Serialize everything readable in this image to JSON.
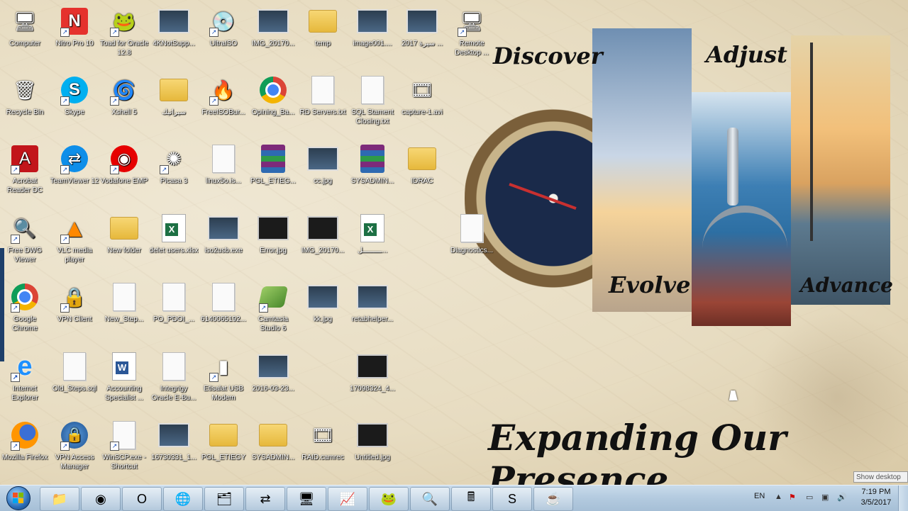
{
  "wallpaper": {
    "discover": "Discover",
    "adjust": "Adjust",
    "evolve": "Evolve",
    "advance": "Advance",
    "slogan": "Expanding Our Presence"
  },
  "icons": [
    {
      "label": "Computer",
      "glyph": "🖥",
      "type": "glyph",
      "name": "computer-icon",
      "shortcut": false
    },
    {
      "label": "Nitro Pro 10",
      "glyph": "N",
      "type": "nitro",
      "name": "nitro-pro-icon",
      "shortcut": true
    },
    {
      "label": "Toad for Oracle 12.8",
      "glyph": "🐸",
      "type": "glyph",
      "name": "toad-icon",
      "shortcut": true
    },
    {
      "label": "4KNotSupp...",
      "glyph": "",
      "type": "img",
      "name": "image-file-icon",
      "shortcut": false
    },
    {
      "label": "UltraISO",
      "glyph": "💿",
      "type": "glyph",
      "name": "ultraiso-icon",
      "shortcut": true
    },
    {
      "label": "IMG_20170...",
      "glyph": "",
      "type": "img",
      "name": "image-file-icon",
      "shortcut": false
    },
    {
      "label": "temp",
      "glyph": "",
      "type": "folder",
      "name": "folder-icon",
      "shortcut": false
    },
    {
      "label": "image001....",
      "glyph": "",
      "type": "img",
      "name": "image-file-icon",
      "shortcut": false
    },
    {
      "label": "2017 سيرة ...",
      "glyph": "",
      "type": "img",
      "name": "image-file-icon",
      "shortcut": false
    },
    {
      "label": "Remote Desktop ...",
      "glyph": "🖥",
      "type": "glyph",
      "name": "remote-desktop-icon",
      "shortcut": true
    },
    {
      "label": "Recycle Bin",
      "glyph": "🗑",
      "type": "glyph",
      "name": "recycle-bin-icon",
      "shortcut": false
    },
    {
      "label": "Skype",
      "glyph": "S",
      "type": "skype",
      "name": "skype-icon",
      "shortcut": true
    },
    {
      "label": "Xshell 5",
      "glyph": "🌀",
      "type": "glyph",
      "name": "xshell-icon",
      "shortcut": true
    },
    {
      "label": "سيراتيك",
      "glyph": "",
      "type": "folder",
      "name": "folder-icon",
      "shortcut": false
    },
    {
      "label": "FreeISOBur...",
      "glyph": "🔥",
      "type": "glyph",
      "name": "freeisoburner-icon",
      "shortcut": true
    },
    {
      "label": "Opining_Ba...",
      "glyph": "",
      "type": "chrome",
      "name": "chrome-html-icon",
      "shortcut": false
    },
    {
      "label": "RD Servers.txt",
      "glyph": "",
      "type": "file",
      "name": "text-file-icon",
      "shortcut": false
    },
    {
      "label": "SQL Stament Closing.txt",
      "glyph": "",
      "type": "file",
      "name": "text-file-icon",
      "shortcut": false
    },
    {
      "label": "capture-1.avi",
      "glyph": "🎞",
      "type": "glyph",
      "name": "video-file-icon",
      "shortcut": false
    },
    {
      "label": "Acrobat Reader DC",
      "glyph": "A",
      "type": "acrobat",
      "name": "acrobat-icon",
      "shortcut": true
    },
    {
      "label": "TeamViewer 12",
      "glyph": "⇄",
      "type": "teamviewer",
      "name": "teamviewer-icon",
      "shortcut": true
    },
    {
      "label": "Vodafone EMP",
      "glyph": "◉",
      "type": "vodafone",
      "name": "vodafone-icon",
      "shortcut": true
    },
    {
      "label": "Picasa 3",
      "glyph": "✺",
      "type": "glyph",
      "name": "picasa-icon",
      "shortcut": true
    },
    {
      "label": "linux5o.is...",
      "glyph": "",
      "type": "file",
      "name": "iso-file-icon",
      "shortcut": false
    },
    {
      "label": "PGL_ETIEG...",
      "glyph": "",
      "type": "rar",
      "name": "rar-archive-icon",
      "shortcut": false
    },
    {
      "label": "cc.jpg",
      "glyph": "",
      "type": "img",
      "name": "image-file-icon",
      "shortcut": false
    },
    {
      "label": "SYSADMIN...",
      "glyph": "",
      "type": "rar",
      "name": "rar-archive-icon",
      "shortcut": false
    },
    {
      "label": "IDRAC",
      "glyph": "",
      "type": "folder",
      "name": "folder-icon",
      "shortcut": false
    },
    {
      "label": "Free DWG Viewer",
      "glyph": "🔍",
      "type": "glyph",
      "name": "dwg-viewer-icon",
      "shortcut": true
    },
    {
      "label": "VLC media player",
      "glyph": "🔺",
      "type": "vlc",
      "name": "vlc-icon",
      "shortcut": true
    },
    {
      "label": "New folder",
      "glyph": "",
      "type": "folder",
      "name": "folder-icon",
      "shortcut": false
    },
    {
      "label": "delet users.xlsx",
      "glyph": "",
      "type": "excel",
      "name": "excel-file-icon",
      "shortcut": false
    },
    {
      "label": "iso2usb.exe",
      "glyph": "",
      "type": "img",
      "name": "exe-file-icon",
      "shortcut": false
    },
    {
      "label": "Error.jpg",
      "glyph": "",
      "type": "dark",
      "name": "image-file-icon",
      "shortcut": false
    },
    {
      "label": "IMG_20170...",
      "glyph": "",
      "type": "dark",
      "name": "image-file-icon",
      "shortcut": false
    },
    {
      "label": "ـــــــــل...",
      "glyph": "",
      "type": "excel",
      "name": "excel-file-icon",
      "shortcut": false
    },
    {
      "label": "Diagnostics...",
      "glyph": "",
      "type": "file",
      "name": "text-file-icon",
      "shortcut": false
    },
    {
      "label": "Google Chrome",
      "glyph": "",
      "type": "chrome",
      "name": "chrome-icon",
      "shortcut": true
    },
    {
      "label": "VPN Client",
      "glyph": "🔒",
      "type": "glyph",
      "name": "vpn-client-icon",
      "shortcut": true
    },
    {
      "label": "New_Step...",
      "glyph": "",
      "type": "file",
      "name": "text-file-icon",
      "shortcut": false
    },
    {
      "label": "PO_PDOI_...",
      "glyph": "",
      "type": "file",
      "name": "text-file-icon",
      "shortcut": false
    },
    {
      "label": "6140065192...",
      "glyph": "",
      "type": "file",
      "name": "pdf-file-icon",
      "shortcut": false
    },
    {
      "label": "Camtasia Studio 6",
      "glyph": "",
      "type": "camtasia",
      "name": "camtasia-icon",
      "shortcut": true
    },
    {
      "label": "kk.jpg",
      "glyph": "",
      "type": "img",
      "name": "image-file-icon",
      "shortcut": false
    },
    {
      "label": "retabhelper...",
      "glyph": "",
      "type": "img",
      "name": "window-file-icon",
      "shortcut": false
    },
    {
      "label": "Internet Explorer",
      "glyph": "e",
      "type": "ie",
      "name": "internet-explorer-icon",
      "shortcut": true
    },
    {
      "label": "Old_Steps.sql",
      "glyph": "",
      "type": "file",
      "name": "sql-file-icon",
      "shortcut": false
    },
    {
      "label": "Accounting Specialist ...",
      "glyph": "",
      "type": "word",
      "name": "word-file-icon",
      "shortcut": false
    },
    {
      "label": "Integrigy Oracle E-Bu...",
      "glyph": "",
      "type": "file",
      "name": "pdf-file-icon",
      "shortcut": false
    },
    {
      "label": "Etisalat USB Modem",
      "glyph": "▮",
      "type": "glyph",
      "name": "usb-modem-icon",
      "shortcut": true
    },
    {
      "label": "2016-03-23...",
      "glyph": "",
      "type": "img",
      "name": "image-file-icon",
      "shortcut": false
    },
    {
      "label": "17098324_4...",
      "glyph": "",
      "type": "dark",
      "name": "image-file-icon",
      "shortcut": false
    },
    {
      "label": "Mozilla Firefox",
      "glyph": "",
      "type": "firefox",
      "name": "firefox-icon",
      "shortcut": true
    },
    {
      "label": "VPN Access Manager",
      "glyph": "🔒",
      "type": "vpnmgr",
      "name": "vpn-access-manager-icon",
      "shortcut": true
    },
    {
      "label": "WinSCP.exe - Shortcut",
      "glyph": "",
      "type": "file",
      "name": "winscp-icon",
      "shortcut": true
    },
    {
      "label": "16730331_1...",
      "glyph": "",
      "type": "img",
      "name": "image-file-icon",
      "shortcut": false
    },
    {
      "label": "PGL_ETIEGY",
      "glyph": "",
      "type": "folder",
      "name": "folder-icon",
      "shortcut": false
    },
    {
      "label": "SYSADMIN...",
      "glyph": "",
      "type": "folder",
      "name": "folder-icon",
      "shortcut": false
    },
    {
      "label": "RAID.camrec",
      "glyph": "🎞",
      "type": "glyph",
      "name": "camrec-file-icon",
      "shortcut": false
    },
    {
      "label": "Untitled.jpg",
      "glyph": "",
      "type": "dark",
      "name": "image-file-icon",
      "shortcut": false
    }
  ],
  "taskbar": {
    "buttons": [
      {
        "name": "taskbar-explorer-libraries",
        "glyph": "📁"
      },
      {
        "name": "taskbar-chrome",
        "glyph": "◉"
      },
      {
        "name": "taskbar-outlook",
        "glyph": "O"
      },
      {
        "name": "taskbar-globe",
        "glyph": "🌐"
      },
      {
        "name": "taskbar-file-explorer",
        "glyph": "🗂"
      },
      {
        "name": "taskbar-teamviewer",
        "glyph": "⇄"
      },
      {
        "name": "taskbar-remote-desktop",
        "glyph": "🖥"
      },
      {
        "name": "taskbar-task-manager",
        "glyph": "📈"
      },
      {
        "name": "taskbar-toad",
        "glyph": "🐸"
      },
      {
        "name": "taskbar-search",
        "glyph": "🔍"
      },
      {
        "name": "taskbar-calculator",
        "glyph": "🖩"
      },
      {
        "name": "taskbar-sqldev",
        "glyph": "S"
      },
      {
        "name": "taskbar-java",
        "glyph": "☕"
      }
    ],
    "language": "EN",
    "time": "7:19 PM",
    "date": "3/5/2017",
    "show_desktop_tooltip": "Show desktop"
  }
}
